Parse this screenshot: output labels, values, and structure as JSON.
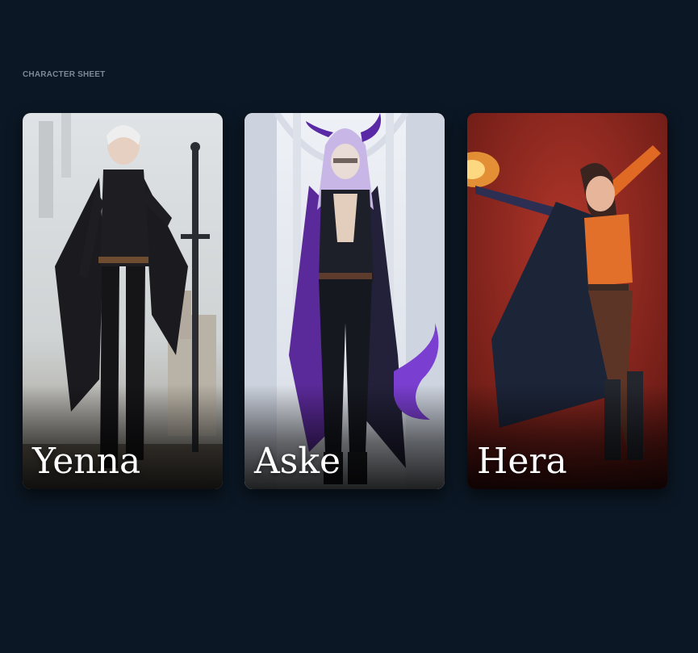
{
  "page": {
    "section_label": "CHARACTER SHEET"
  },
  "characters": [
    {
      "name": "Yenna",
      "portrait": "elf-swordswoman-portrait"
    },
    {
      "name": "Aske",
      "portrait": "horned-mage-portrait"
    },
    {
      "name": "Hera",
      "portrait": "fire-caster-portrait"
    }
  ],
  "theme": {
    "background": "#0b1724",
    "label_color": "#7d8896",
    "name_color": "#ffffff"
  }
}
